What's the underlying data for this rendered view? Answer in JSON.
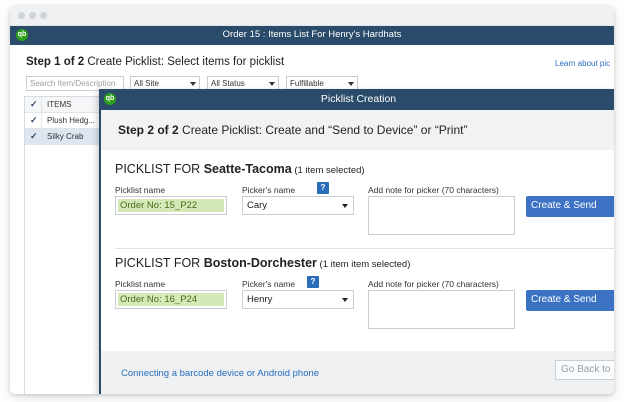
{
  "window": {
    "title": "Order 15 : Items List For Henry's Hardhats"
  },
  "step1": {
    "step_bold": "Step 1 of 2",
    "text": " Create Picklist: Select items for picklist",
    "learn_link": "Learn about pic"
  },
  "filters": {
    "search_placeholder": "Search Item/Description",
    "site": "All Site",
    "status": "All Status",
    "fulfillable": "Fulfillable"
  },
  "items_table": {
    "header": "ITEMS",
    "rows": [
      {
        "label": "Plush Hedg...",
        "checked": true
      },
      {
        "label": "Silky Crab",
        "checked": true
      }
    ],
    "check_glyph": "✓"
  },
  "modal": {
    "title": "Picklist Creation",
    "step_bold": "Step 2 of 2",
    "step_text": " Create Picklist: Create and “Send to Device” or “Print”",
    "labels": {
      "picklist_name": "Picklist name",
      "pickers_name": "Picker's name",
      "note": "Add note for picker (70 characters)",
      "help": "?"
    },
    "picklists": [
      {
        "prefix": "PICKLIST FOR ",
        "location": "Seatte-Tacoma",
        "count": " (1 item selected)",
        "picklist_name": "Order No: 15_P22",
        "picker": "Cary",
        "button": "Create & Send"
      },
      {
        "prefix": "PICKLIST FOR ",
        "location": "Boston-Dorchester",
        "count": " (1 item item selected)",
        "picklist_name": "Order No: 16_P24",
        "picker": "Henry",
        "button": "Create & Send"
      }
    ],
    "footer": {
      "link": "Connecting a barcode device or Android phone",
      "back_button": "Go Back to"
    }
  },
  "logo_text": "qb",
  "colors": {
    "titlebar": "#2b4b6b",
    "primary_button": "#3b72c4",
    "link": "#2a6ebb",
    "name_highlight": "#d5e8b7"
  }
}
